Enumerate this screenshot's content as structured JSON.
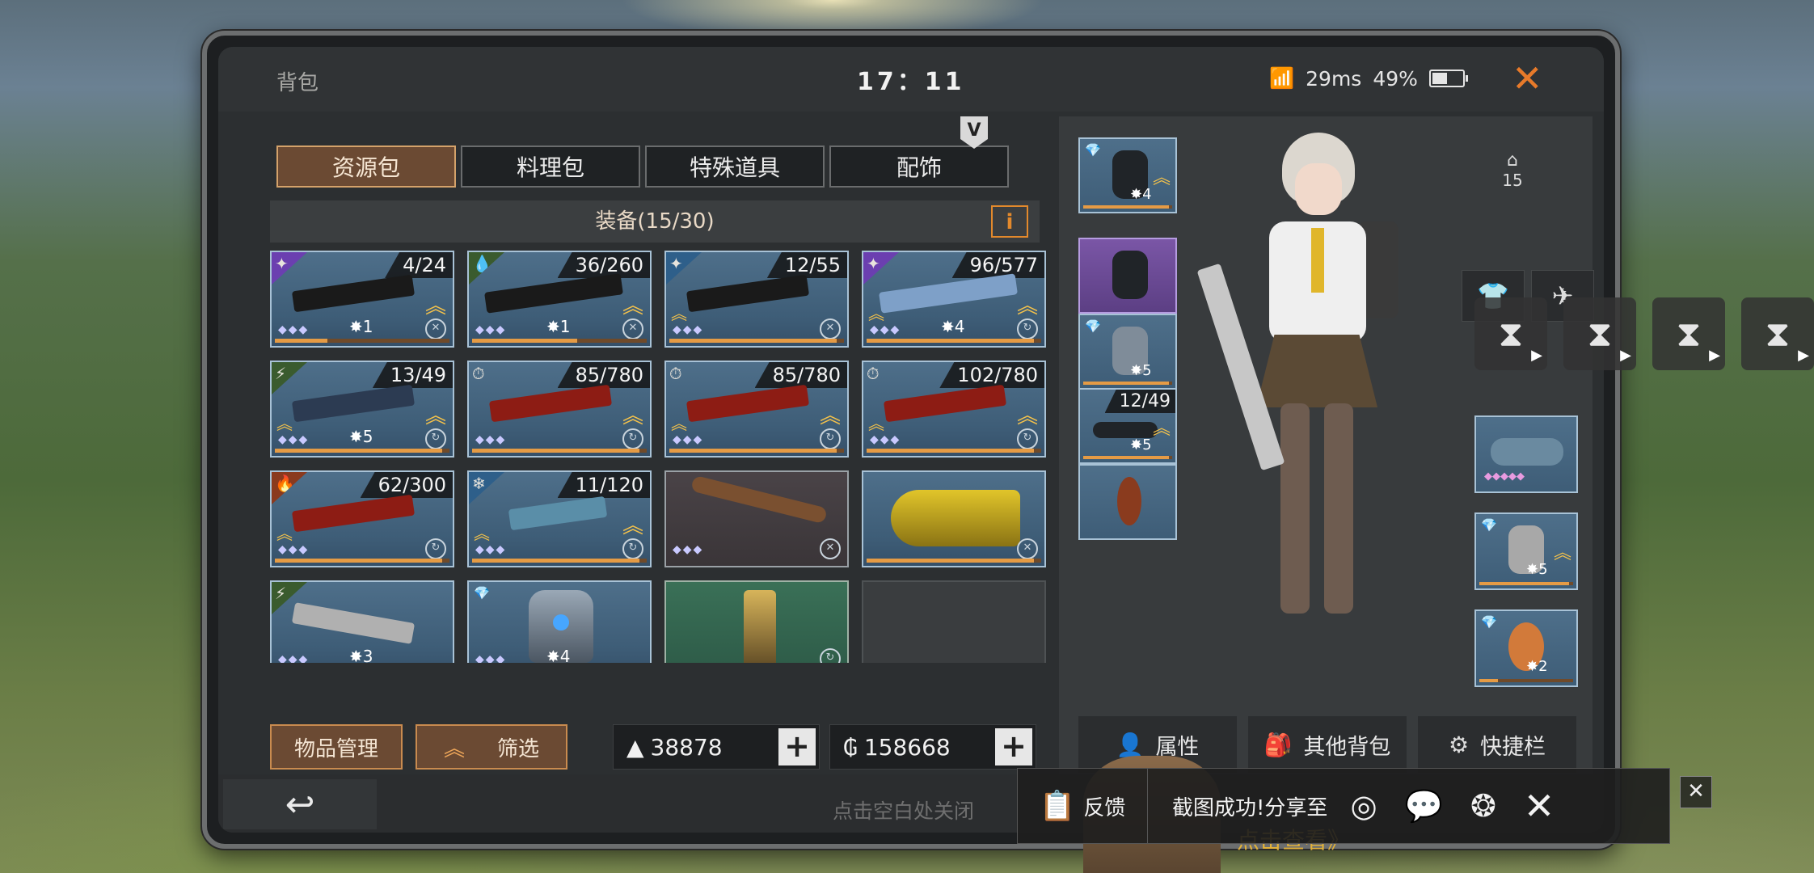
{
  "header": {
    "title": "背包",
    "clock": "17：11",
    "ping": "29ms",
    "battery": "49%",
    "battery_level": 0.49
  },
  "tabs": [
    "资源包",
    "料理包",
    "特殊道具",
    "配饰"
  ],
  "v_badge": "V",
  "equipment": {
    "label": "装备(15/30)",
    "info_label": "i"
  },
  "items": [
    {
      "count": "4/24",
      "level": "1",
      "corner_color": "#6b3fb0"
    },
    {
      "count": "36/260",
      "level": "1",
      "corner_color": "#3a5b2e"
    },
    {
      "count": "12/55",
      "corner_color": "#2e5f8a"
    },
    {
      "count": "96/577",
      "level": "4",
      "corner_color": "#6b3fb0"
    },
    {
      "count": "13/49",
      "level": "5",
      "corner_color": "#3a5b2e"
    },
    {
      "count": "85/780"
    },
    {
      "count": "85/780"
    },
    {
      "count": "102/780"
    },
    {
      "count": "62/300",
      "corner_color": "#8a3a1e"
    },
    {
      "count": "11/120",
      "corner_color": "#2e5f8a"
    },
    {},
    {},
    {
      "level": "3"
    },
    {
      "level": "4"
    },
    {},
    {}
  ],
  "buttons": {
    "manage": "物品管理",
    "filter": "筛选"
  },
  "currency": {
    "silver": "38878",
    "gold": "158668"
  },
  "right_slots": {
    "helmet_level": "4",
    "armor_level": "5",
    "weapon_count": "12/49",
    "weapon_level": "5",
    "item_level": "5",
    "cannon_level": "2"
  },
  "house_level": "15",
  "right_buttons": {
    "attributes": "属性",
    "other_bag": "其他背包",
    "shortcut": "快捷栏"
  },
  "footer": {
    "back_icon": "↩",
    "close_hint": "点击空白处关闭"
  },
  "toast": {
    "feedback": "反馈",
    "message": "截图成功!分享至"
  },
  "promo": "点击查看》"
}
